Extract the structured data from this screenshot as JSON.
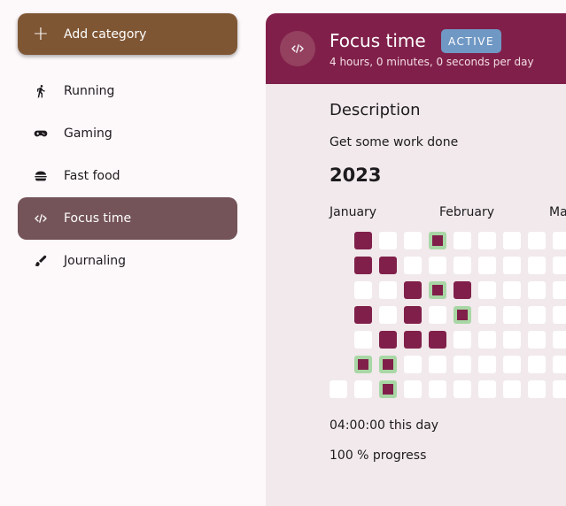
{
  "sidebar": {
    "add_button": {
      "label": "Add category",
      "icon": "plus-icon"
    },
    "items": [
      {
        "label": "Running",
        "icon": "running-icon",
        "active": false
      },
      {
        "label": "Gaming",
        "icon": "gamepad-icon",
        "active": false
      },
      {
        "label": "Fast food",
        "icon": "burger-icon",
        "active": false
      },
      {
        "label": "Focus time",
        "icon": "code-icon",
        "active": true
      },
      {
        "label": "Journaling",
        "icon": "pen-icon",
        "active": false
      }
    ]
  },
  "header": {
    "icon": "code-icon",
    "title": "Focus time",
    "badge": "ACTIVE",
    "subtitle": "4 hours, 0 minutes, 0 seconds per day"
  },
  "detail": {
    "description_heading": "Description",
    "description": "Get some work done",
    "year": "2023",
    "months": [
      "January",
      "February",
      "Ma"
    ],
    "heatmap": [
      [
        "blank",
        "filled",
        "empty",
        "empty",
        "marked",
        "empty",
        "empty",
        "empty",
        "empty",
        "empty",
        "empty"
      ],
      [
        "blank",
        "filled",
        "filled",
        "empty",
        "empty",
        "empty",
        "empty",
        "empty",
        "empty",
        "empty",
        "empty"
      ],
      [
        "blank",
        "empty",
        "empty",
        "filled",
        "marked",
        "filled",
        "empty",
        "empty",
        "empty",
        "empty",
        "empty"
      ],
      [
        "blank",
        "filled",
        "empty",
        "filled",
        "empty",
        "marked",
        "empty",
        "empty",
        "empty",
        "empty",
        "empty"
      ],
      [
        "blank",
        "empty",
        "filled",
        "filled",
        "filled",
        "empty",
        "empty",
        "empty",
        "empty",
        "empty",
        "empty"
      ],
      [
        "blank",
        "marked",
        "marked",
        "empty",
        "empty",
        "empty",
        "empty",
        "empty",
        "empty",
        "empty",
        "empty"
      ],
      [
        "empty",
        "empty",
        "marked",
        "empty",
        "empty",
        "empty",
        "empty",
        "empty",
        "empty",
        "empty",
        "empty"
      ]
    ],
    "time_today": "04:00:00 this day",
    "progress": "100 % progress"
  },
  "colors": {
    "accent": "#80204a",
    "add_button": "#7f5634",
    "active_item": "#745459",
    "badge": "#7098c4",
    "marked_day": "#a8d7a5"
  }
}
